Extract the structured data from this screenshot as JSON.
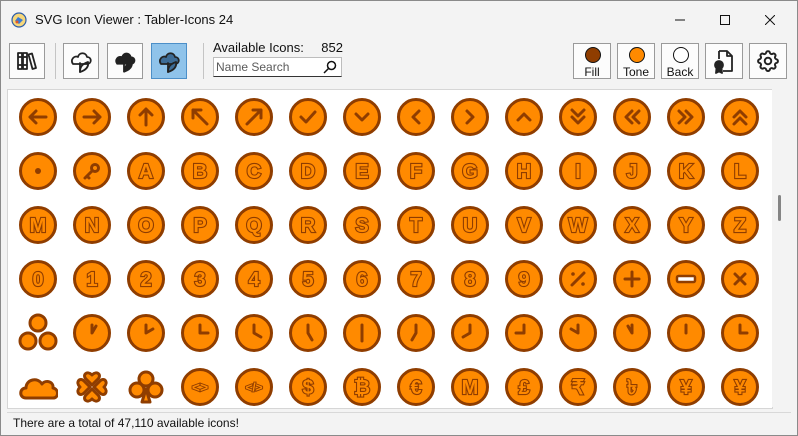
{
  "window": {
    "title": "SVG Icon Viewer : Tabler-Icons 24",
    "app_icon": "svg-viewer-app-icon",
    "controls": [
      "minimize-icon",
      "maximize-icon",
      "close-icon"
    ]
  },
  "toolbar": {
    "buttons": [
      "library-icon",
      "plant-outline-icon",
      "plant-filled-icon",
      "plant-duotone-icon"
    ],
    "active_button": "plant-duotone-icon",
    "available_label": "Available Icons:",
    "available_count": "852",
    "search_placeholder": "Name Search",
    "search_value": "",
    "fill_label": "Fill",
    "tone_label": "Tone",
    "back_label": "Back",
    "file_button_icon": "file-certificate-icon",
    "settings_icon": "settings-gear-icon"
  },
  "colors": {
    "fill": "#8f3d00",
    "tone": "#ff8a00",
    "back": "#ffffff",
    "icon_dark": "#8f3d00",
    "icon_light": "#ff8a00",
    "active_button": "#8fc3ea"
  },
  "icons": [
    {
      "name": "circle-arrow-left",
      "glyph": "arrow-left"
    },
    {
      "name": "circle-arrow-right",
      "glyph": "arrow-right"
    },
    {
      "name": "circle-arrow-up",
      "glyph": "arrow-up"
    },
    {
      "name": "circle-arrow-up-left",
      "glyph": "arrow-up-left"
    },
    {
      "name": "circle-arrow-up-right",
      "glyph": "arrow-up-right"
    },
    {
      "name": "circle-check",
      "glyph": "check"
    },
    {
      "name": "circle-chevron-down",
      "glyph": "chevron-down"
    },
    {
      "name": "circle-chevron-left",
      "glyph": "chevron-left"
    },
    {
      "name": "circle-chevron-right",
      "glyph": "chevron-right"
    },
    {
      "name": "circle-chevron-up",
      "glyph": "chevron-up"
    },
    {
      "name": "circle-chevrons-down",
      "glyph": "chevrons-down"
    },
    {
      "name": "circle-chevrons-left",
      "glyph": "chevrons-left"
    },
    {
      "name": "circle-chevrons-right",
      "glyph": "chevrons-right"
    },
    {
      "name": "circle-chevrons-up",
      "glyph": "chevrons-up"
    },
    {
      "name": "circle-dot",
      "glyph": "dot"
    },
    {
      "name": "circle-key",
      "glyph": "key"
    },
    {
      "name": "circle-letter-a",
      "glyph": "text",
      "text": "A"
    },
    {
      "name": "circle-letter-b",
      "glyph": "text",
      "text": "B"
    },
    {
      "name": "circle-letter-c",
      "glyph": "text",
      "text": "C"
    },
    {
      "name": "circle-letter-d",
      "glyph": "text",
      "text": "D"
    },
    {
      "name": "circle-letter-e",
      "glyph": "text",
      "text": "E"
    },
    {
      "name": "circle-letter-f",
      "glyph": "text",
      "text": "F"
    },
    {
      "name": "circle-letter-g",
      "glyph": "text",
      "text": "G"
    },
    {
      "name": "circle-letter-h",
      "glyph": "text",
      "text": "H"
    },
    {
      "name": "circle-letter-i",
      "glyph": "text",
      "text": "I"
    },
    {
      "name": "circle-letter-j",
      "glyph": "text",
      "text": "J"
    },
    {
      "name": "circle-letter-k",
      "glyph": "text",
      "text": "K"
    },
    {
      "name": "circle-letter-l",
      "glyph": "text",
      "text": "L"
    },
    {
      "name": "circle-letter-m",
      "glyph": "text",
      "text": "M"
    },
    {
      "name": "circle-letter-n",
      "glyph": "text",
      "text": "N"
    },
    {
      "name": "circle-letter-o",
      "glyph": "text",
      "text": "O"
    },
    {
      "name": "circle-letter-p",
      "glyph": "text",
      "text": "P"
    },
    {
      "name": "circle-letter-q",
      "glyph": "text",
      "text": "Q"
    },
    {
      "name": "circle-letter-r",
      "glyph": "text",
      "text": "R"
    },
    {
      "name": "circle-letter-s",
      "glyph": "text",
      "text": "S"
    },
    {
      "name": "circle-letter-t",
      "glyph": "text",
      "text": "T"
    },
    {
      "name": "circle-letter-u",
      "glyph": "text",
      "text": "U"
    },
    {
      "name": "circle-letter-v",
      "glyph": "text",
      "text": "V"
    },
    {
      "name": "circle-letter-w",
      "glyph": "text",
      "text": "W"
    },
    {
      "name": "circle-letter-x",
      "glyph": "text",
      "text": "X"
    },
    {
      "name": "circle-letter-y",
      "glyph": "text",
      "text": "Y"
    },
    {
      "name": "circle-letter-z",
      "glyph": "text",
      "text": "Z"
    },
    {
      "name": "circle-number-0",
      "glyph": "text",
      "text": "0"
    },
    {
      "name": "circle-number-1",
      "glyph": "text",
      "text": "1"
    },
    {
      "name": "circle-number-2",
      "glyph": "text",
      "text": "2"
    },
    {
      "name": "circle-number-3",
      "glyph": "text",
      "text": "3"
    },
    {
      "name": "circle-number-4",
      "glyph": "text",
      "text": "4"
    },
    {
      "name": "circle-number-5",
      "glyph": "text",
      "text": "5"
    },
    {
      "name": "circle-number-6",
      "glyph": "text",
      "text": "6"
    },
    {
      "name": "circle-number-7",
      "glyph": "text",
      "text": "7"
    },
    {
      "name": "circle-number-8",
      "glyph": "text",
      "text": "8"
    },
    {
      "name": "circle-number-9",
      "glyph": "text",
      "text": "9"
    },
    {
      "name": "circle-percentage",
      "glyph": "percent"
    },
    {
      "name": "circle-plus",
      "glyph": "plus"
    },
    {
      "name": "circle-minus",
      "glyph": "minus"
    },
    {
      "name": "circle-x",
      "glyph": "x"
    },
    {
      "name": "circles",
      "glyph": "circles"
    },
    {
      "name": "clock-hour-1",
      "glyph": "clock",
      "h": 1
    },
    {
      "name": "clock-hour-2",
      "glyph": "clock",
      "h": 2
    },
    {
      "name": "clock-hour-3",
      "glyph": "clock",
      "h": 3
    },
    {
      "name": "clock-hour-4",
      "glyph": "clock",
      "h": 4
    },
    {
      "name": "clock-hour-5",
      "glyph": "clock",
      "h": 5
    },
    {
      "name": "clock-hour-6",
      "glyph": "clock",
      "h": 6
    },
    {
      "name": "clock-hour-7",
      "glyph": "clock",
      "h": 7
    },
    {
      "name": "clock-hour-8",
      "glyph": "clock",
      "h": 8
    },
    {
      "name": "clock-hour-9",
      "glyph": "clock",
      "h": 9
    },
    {
      "name": "clock-hour-10",
      "glyph": "clock",
      "h": 10
    },
    {
      "name": "clock-hour-11",
      "glyph": "clock",
      "h": 11
    },
    {
      "name": "clock-hour-12",
      "glyph": "clock",
      "h": 12
    },
    {
      "name": "clock",
      "glyph": "clock",
      "h": 13
    },
    {
      "name": "cloud",
      "glyph": "cloud"
    },
    {
      "name": "clover",
      "glyph": "clover"
    },
    {
      "name": "clubs",
      "glyph": "clubs"
    },
    {
      "name": "code-circle",
      "glyph": "text",
      "text": "<>"
    },
    {
      "name": "code-circle-2",
      "glyph": "text",
      "text": "</>"
    },
    {
      "name": "coin",
      "glyph": "text",
      "text": "$"
    },
    {
      "name": "coin-bitcoin",
      "glyph": "text",
      "text": "₿"
    },
    {
      "name": "coin-euro",
      "glyph": "text",
      "text": "€"
    },
    {
      "name": "coin-monero",
      "glyph": "text",
      "text": "M"
    },
    {
      "name": "coin-pound",
      "glyph": "text",
      "text": "£"
    },
    {
      "name": "coin-rupee",
      "glyph": "text",
      "text": "₹"
    },
    {
      "name": "coin-taka",
      "glyph": "text",
      "text": "৳"
    },
    {
      "name": "coin-yen",
      "glyph": "text",
      "text": "¥"
    },
    {
      "name": "coin-yuan",
      "glyph": "text",
      "text": "¥"
    }
  ],
  "status": {
    "text": "There are a total of 47,110 available icons!"
  }
}
